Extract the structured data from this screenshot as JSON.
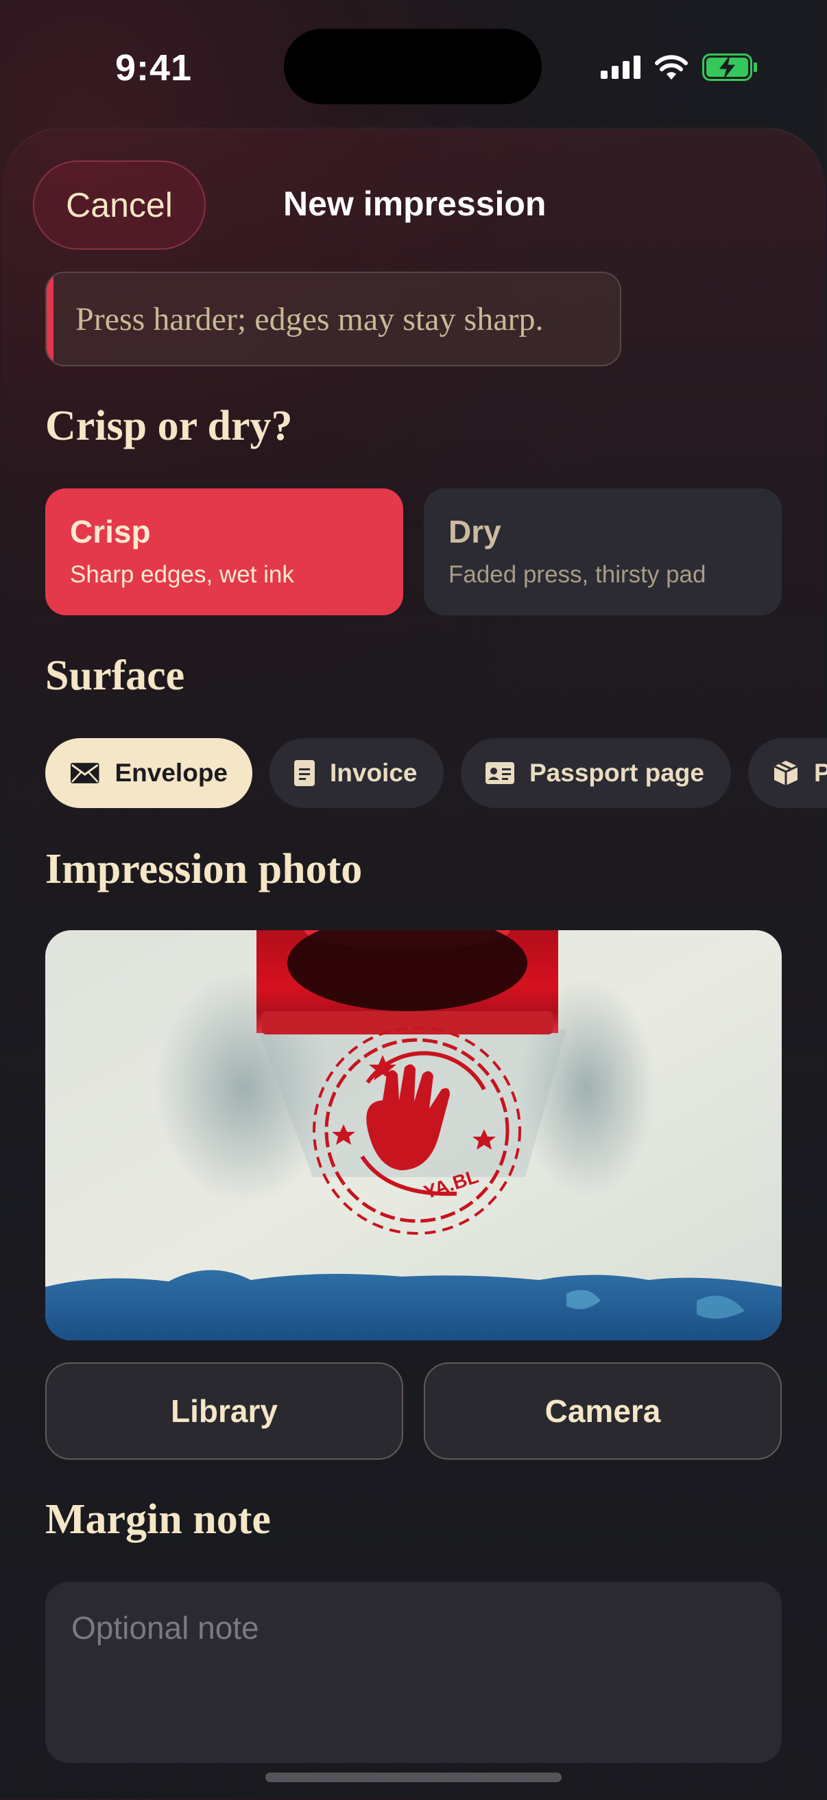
{
  "status_bar": {
    "time": "9:41"
  },
  "header": {
    "cancel_label": "Cancel",
    "title": "New impression"
  },
  "hint": {
    "text": "Press harder; edges may stay sharp."
  },
  "finish": {
    "heading": "Crisp or dry?",
    "options": [
      {
        "title": "Crisp",
        "subtitle": "Sharp edges, wet ink",
        "selected": true
      },
      {
        "title": "Dry",
        "subtitle": "Faded press, thirsty pad",
        "selected": false
      }
    ]
  },
  "surface": {
    "heading": "Surface",
    "chips": [
      {
        "label": "Envelope",
        "icon": "envelope-icon",
        "selected": true
      },
      {
        "label": "Invoice",
        "icon": "document-icon",
        "selected": false
      },
      {
        "label": "Passport page",
        "icon": "id-card-icon",
        "selected": false
      },
      {
        "label": "P",
        "icon": "package-icon",
        "selected": false
      }
    ]
  },
  "photo": {
    "heading": "Impression photo",
    "stamp_text": "YA.BL",
    "library_label": "Library",
    "camera_label": "Camera"
  },
  "note": {
    "heading": "Margin note",
    "placeholder": "Optional note"
  },
  "colors": {
    "accent": "#e4394b",
    "cream": "#f4e6c6",
    "card": "#2c2b33",
    "battery": "#34c759"
  }
}
